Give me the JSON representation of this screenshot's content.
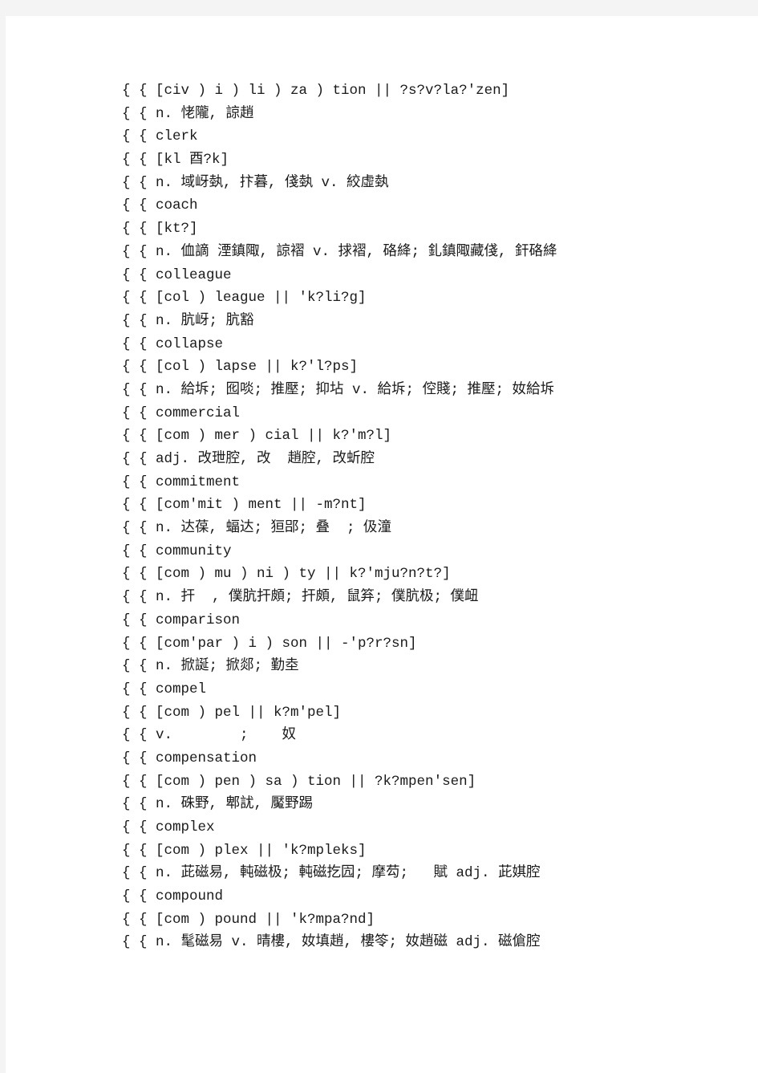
{
  "document": {
    "page_background": "#ffffff",
    "canvas_background": "#f4f4f4",
    "text_color": "#1a1a1a",
    "lines": [
      "{ { [civ ) i ) li ) za ) tion || ?s?v?la?'zen]",
      "{ { n. 恅隴, 諒趙",
      "{ { clerk",
      "{ { [kl 酉?k]",
      "{ { n. 域岈埶, 抃暮, 俴埶 v. 絞虛埶",
      "{ { coach",
      "{ { [kt?]",
      "{ { n. 侐謫 湮鎮陬, 諒褶 v. 捄褶, 硌絳; 釓鎮陬藏俴, 釬硌絳",
      "{ { colleague",
      "{ { [col ) league || 'k?li?g]",
      "{ { n. 肮岈; 肮豁",
      "{ { collapse",
      "{ { [col ) lapse || k?'l?ps]",
      "{ { n. 給坼; 囮啖; 推壓; 抑坫 v. 給坼; 倥賤; 推壓; 奻給坼",
      "{ { commercial",
      "{ { [com ) mer ) cial || k?'m?l]",
      "{ { adj. 改玴腔, 改  趙腔, 改蚚腔",
      "{ { commitment",
      "{ { [com'mit ) ment || -m?nt]",
      "{ { n. 达葆, 蝠达; 狟郘; 叠  ; 伋潼",
      "{ { community",
      "{ { [com ) mu ) ni ) ty || k?'mju?n?t?]",
      "{ { n. 扞  , 僕肮扞頗; 扞頗, 鼠笲; 僕肮极; 僕衄",
      "{ { comparison",
      "{ { [com'par ) i ) son || -'p?r?sn]",
      "{ { n. 掀誕; 掀郯; 勤坴",
      "{ { compel",
      "{ { [com ) pel || k?m'pel]",
      "{ { v.        ;    奴",
      "{ { compensation",
      "{ { [com ) pen ) sa ) tion || ?k?mpen'sen]",
      "{ { n. 硃野, 郫訧, 魘野踢",
      "{ { complex",
      "{ { [com ) plex || 'k?mpleks]",
      "{ { n. 茈磁易, 軘磁极; 軘磁扢囥; 摩芶;   賦 adj. 茈娸腔",
      "{ { compound",
      "{ { [com ) pound || 'k?mpa?nd]",
      "{ { n. 髦磁易 v. 晴樓, 奻填趙, 樓笭; 奻趙磁 adj. 磁傖腔"
    ]
  }
}
